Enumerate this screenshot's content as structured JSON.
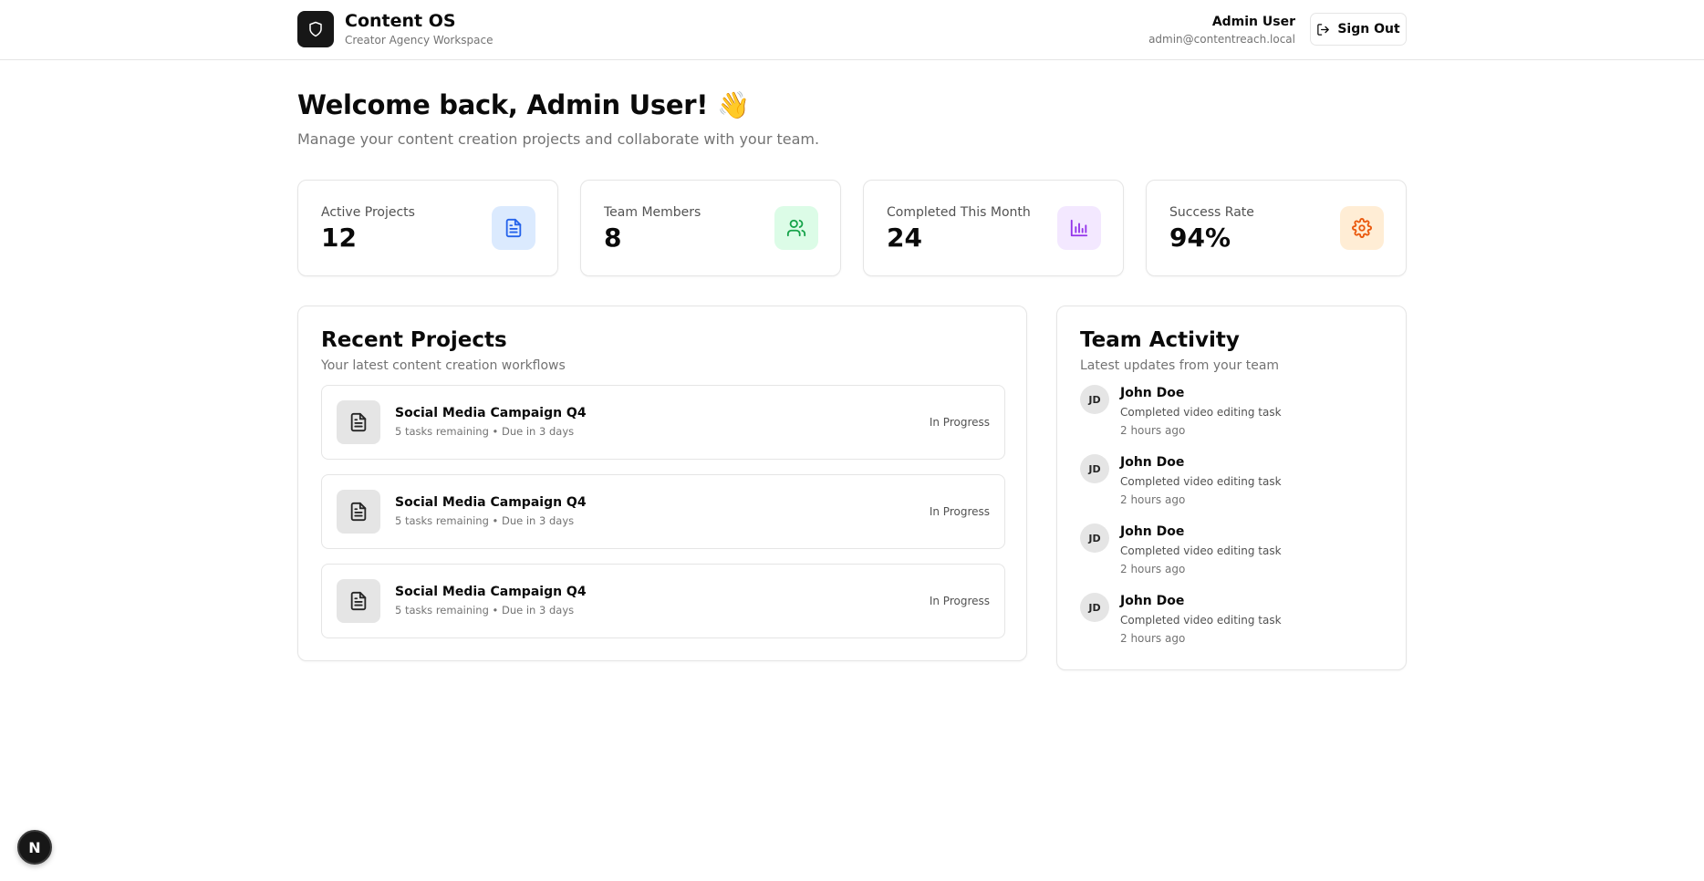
{
  "header": {
    "app_title": "Content OS",
    "app_subtitle": "Creator Agency Workspace",
    "user_name": "Admin User",
    "user_email": "admin@contentreach.local",
    "sign_out_label": "Sign Out",
    "logo_icon": "shield-icon"
  },
  "welcome": {
    "title": "Welcome back, Admin User! 👋",
    "subtitle": "Manage your content creation projects and collaborate with your team."
  },
  "stats": [
    {
      "label": "Active Projects",
      "value": "12",
      "icon": "file-text-icon",
      "bg": "#dbeafe",
      "color": "#2563eb"
    },
    {
      "label": "Team Members",
      "value": "8",
      "icon": "users-icon",
      "bg": "#dcfce7",
      "color": "#16a34a"
    },
    {
      "label": "Completed This Month",
      "value": "24",
      "icon": "bar-chart-icon",
      "bg": "#f3e8ff",
      "color": "#9333ea"
    },
    {
      "label": "Success Rate",
      "value": "94%",
      "icon": "settings-icon",
      "bg": "#ffedd5",
      "color": "#ea580c"
    }
  ],
  "recent_projects": {
    "title": "Recent Projects",
    "subtitle": "Your latest content creation workflows",
    "items": [
      {
        "title": "Social Media Campaign Q4",
        "meta": "5 tasks remaining • Due in 3 days",
        "status": "In Progress"
      },
      {
        "title": "Social Media Campaign Q4",
        "meta": "5 tasks remaining • Due in 3 days",
        "status": "In Progress"
      },
      {
        "title": "Social Media Campaign Q4",
        "meta": "5 tasks remaining • Due in 3 days",
        "status": "In Progress"
      }
    ]
  },
  "team_activity": {
    "title": "Team Activity",
    "subtitle": "Latest updates from your team",
    "items": [
      {
        "initials": "JD",
        "name": "John Doe",
        "description": "Completed video editing task",
        "time": "2 hours ago"
      },
      {
        "initials": "JD",
        "name": "John Doe",
        "description": "Completed video editing task",
        "time": "2 hours ago"
      },
      {
        "initials": "JD",
        "name": "John Doe",
        "description": "Completed video editing task",
        "time": "2 hours ago"
      },
      {
        "initials": "JD",
        "name": "John Doe",
        "description": "Completed video editing task",
        "time": "2 hours ago"
      }
    ]
  },
  "dev_badge": {
    "label": "N"
  }
}
